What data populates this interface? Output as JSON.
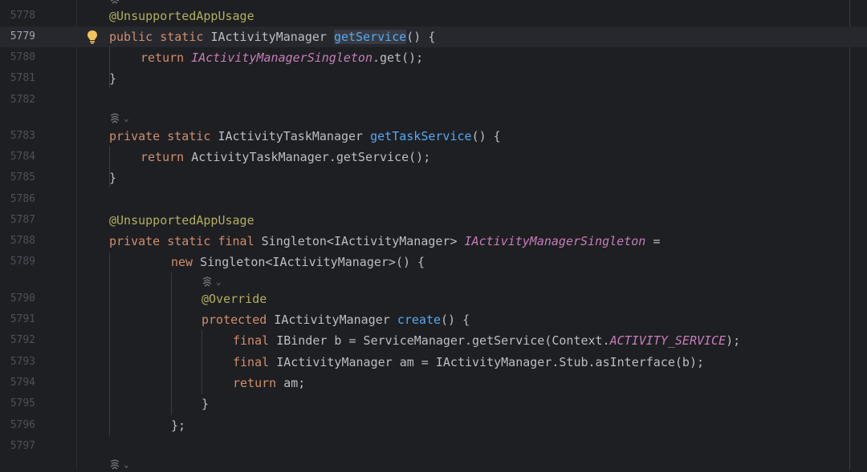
{
  "editor": {
    "lines": [
      {
        "num": "5778",
        "indent": 0,
        "tokens": [
          {
            "t": "ann",
            "v": "@UnsupportedAppUsage"
          }
        ]
      },
      {
        "num": "5779",
        "indent": 0,
        "current": true,
        "tokens": [
          {
            "t": "kw",
            "v": "public static "
          },
          {
            "t": "plain",
            "v": "IActivityManager "
          },
          {
            "t": "fn-hl",
            "v": "getService"
          },
          {
            "t": "plain",
            "v": "() {"
          }
        ]
      },
      {
        "num": "5780",
        "indent": 1,
        "tokens": [
          {
            "t": "kw",
            "v": "return "
          },
          {
            "t": "fld",
            "v": "IActivityManagerSingleton"
          },
          {
            "t": "plain",
            "v": ".get();"
          }
        ]
      },
      {
        "num": "5781",
        "indent": 0,
        "tokens": [
          {
            "t": "plain",
            "v": "}"
          }
        ]
      },
      {
        "num": "5782",
        "indent": 0,
        "tokens": []
      },
      {
        "num": "5783",
        "indent": 0,
        "tokens": [
          {
            "t": "kw",
            "v": "private static "
          },
          {
            "t": "plain",
            "v": "IActivityTaskManager "
          },
          {
            "t": "fn",
            "v": "getTaskService"
          },
          {
            "t": "plain",
            "v": "() {"
          }
        ]
      },
      {
        "num": "5784",
        "indent": 1,
        "tokens": [
          {
            "t": "kw",
            "v": "return "
          },
          {
            "t": "plain",
            "v": "ActivityTaskManager.getService();"
          }
        ]
      },
      {
        "num": "5785",
        "indent": 0,
        "tokens": [
          {
            "t": "plain",
            "v": "}"
          }
        ]
      },
      {
        "num": "5786",
        "indent": 0,
        "tokens": []
      },
      {
        "num": "5787",
        "indent": 0,
        "tokens": [
          {
            "t": "ann",
            "v": "@UnsupportedAppUsage"
          }
        ]
      },
      {
        "num": "5788",
        "indent": 0,
        "tokens": [
          {
            "t": "kw",
            "v": "private static final "
          },
          {
            "t": "plain",
            "v": "Singleton<IActivityManager> "
          },
          {
            "t": "fld",
            "v": "IActivityManagerSingleton"
          },
          {
            "t": "plain",
            "v": " ="
          }
        ]
      },
      {
        "num": "5789",
        "indent": 2,
        "tokens": [
          {
            "t": "kw",
            "v": "new "
          },
          {
            "t": "plain",
            "v": "Singleton<IActivityManager>() {"
          }
        ]
      },
      {
        "num": "5790",
        "indent": 3,
        "tokens": [
          {
            "t": "ann",
            "v": "@Override"
          }
        ]
      },
      {
        "num": "5791",
        "indent": 3,
        "tokens": [
          {
            "t": "kw",
            "v": "protected "
          },
          {
            "t": "plain",
            "v": "IActivityManager "
          },
          {
            "t": "fn",
            "v": "create"
          },
          {
            "t": "plain",
            "v": "() {"
          }
        ]
      },
      {
        "num": "5792",
        "indent": 4,
        "tokens": [
          {
            "t": "kw",
            "v": "final "
          },
          {
            "t": "plain",
            "v": "IBinder b = ServiceManager.getService(Context."
          },
          {
            "t": "fld",
            "v": "ACTIVITY_SERVICE"
          },
          {
            "t": "plain",
            "v": ");"
          }
        ]
      },
      {
        "num": "5793",
        "indent": 4,
        "tokens": [
          {
            "t": "kw",
            "v": "final "
          },
          {
            "t": "plain",
            "v": "IActivityManager am = IActivityManager.Stub.asInterface(b);"
          }
        ]
      },
      {
        "num": "5794",
        "indent": 4,
        "tokens": [
          {
            "t": "kw",
            "v": "return "
          },
          {
            "t": "plain",
            "v": "am;"
          }
        ]
      },
      {
        "num": "5795",
        "indent": 3,
        "tokens": [
          {
            "t": "plain",
            "v": "}"
          }
        ]
      },
      {
        "num": "5796",
        "indent": 2,
        "tokens": [
          {
            "t": "plain",
            "v": "};"
          }
        ]
      },
      {
        "num": "5797",
        "indent": 0,
        "tokens": []
      }
    ],
    "inlay_label": "⌄",
    "colors": {
      "background": "#1e1f22",
      "keyword": "#cf8e6d",
      "annotation": "#b3ae60",
      "function": "#56a8f5",
      "field": "#c77dbb",
      "text": "#bcbec4",
      "line_number": "#4b5059"
    },
    "icons": [
      "lightbulb-icon",
      "ai-inlay-icon"
    ]
  }
}
